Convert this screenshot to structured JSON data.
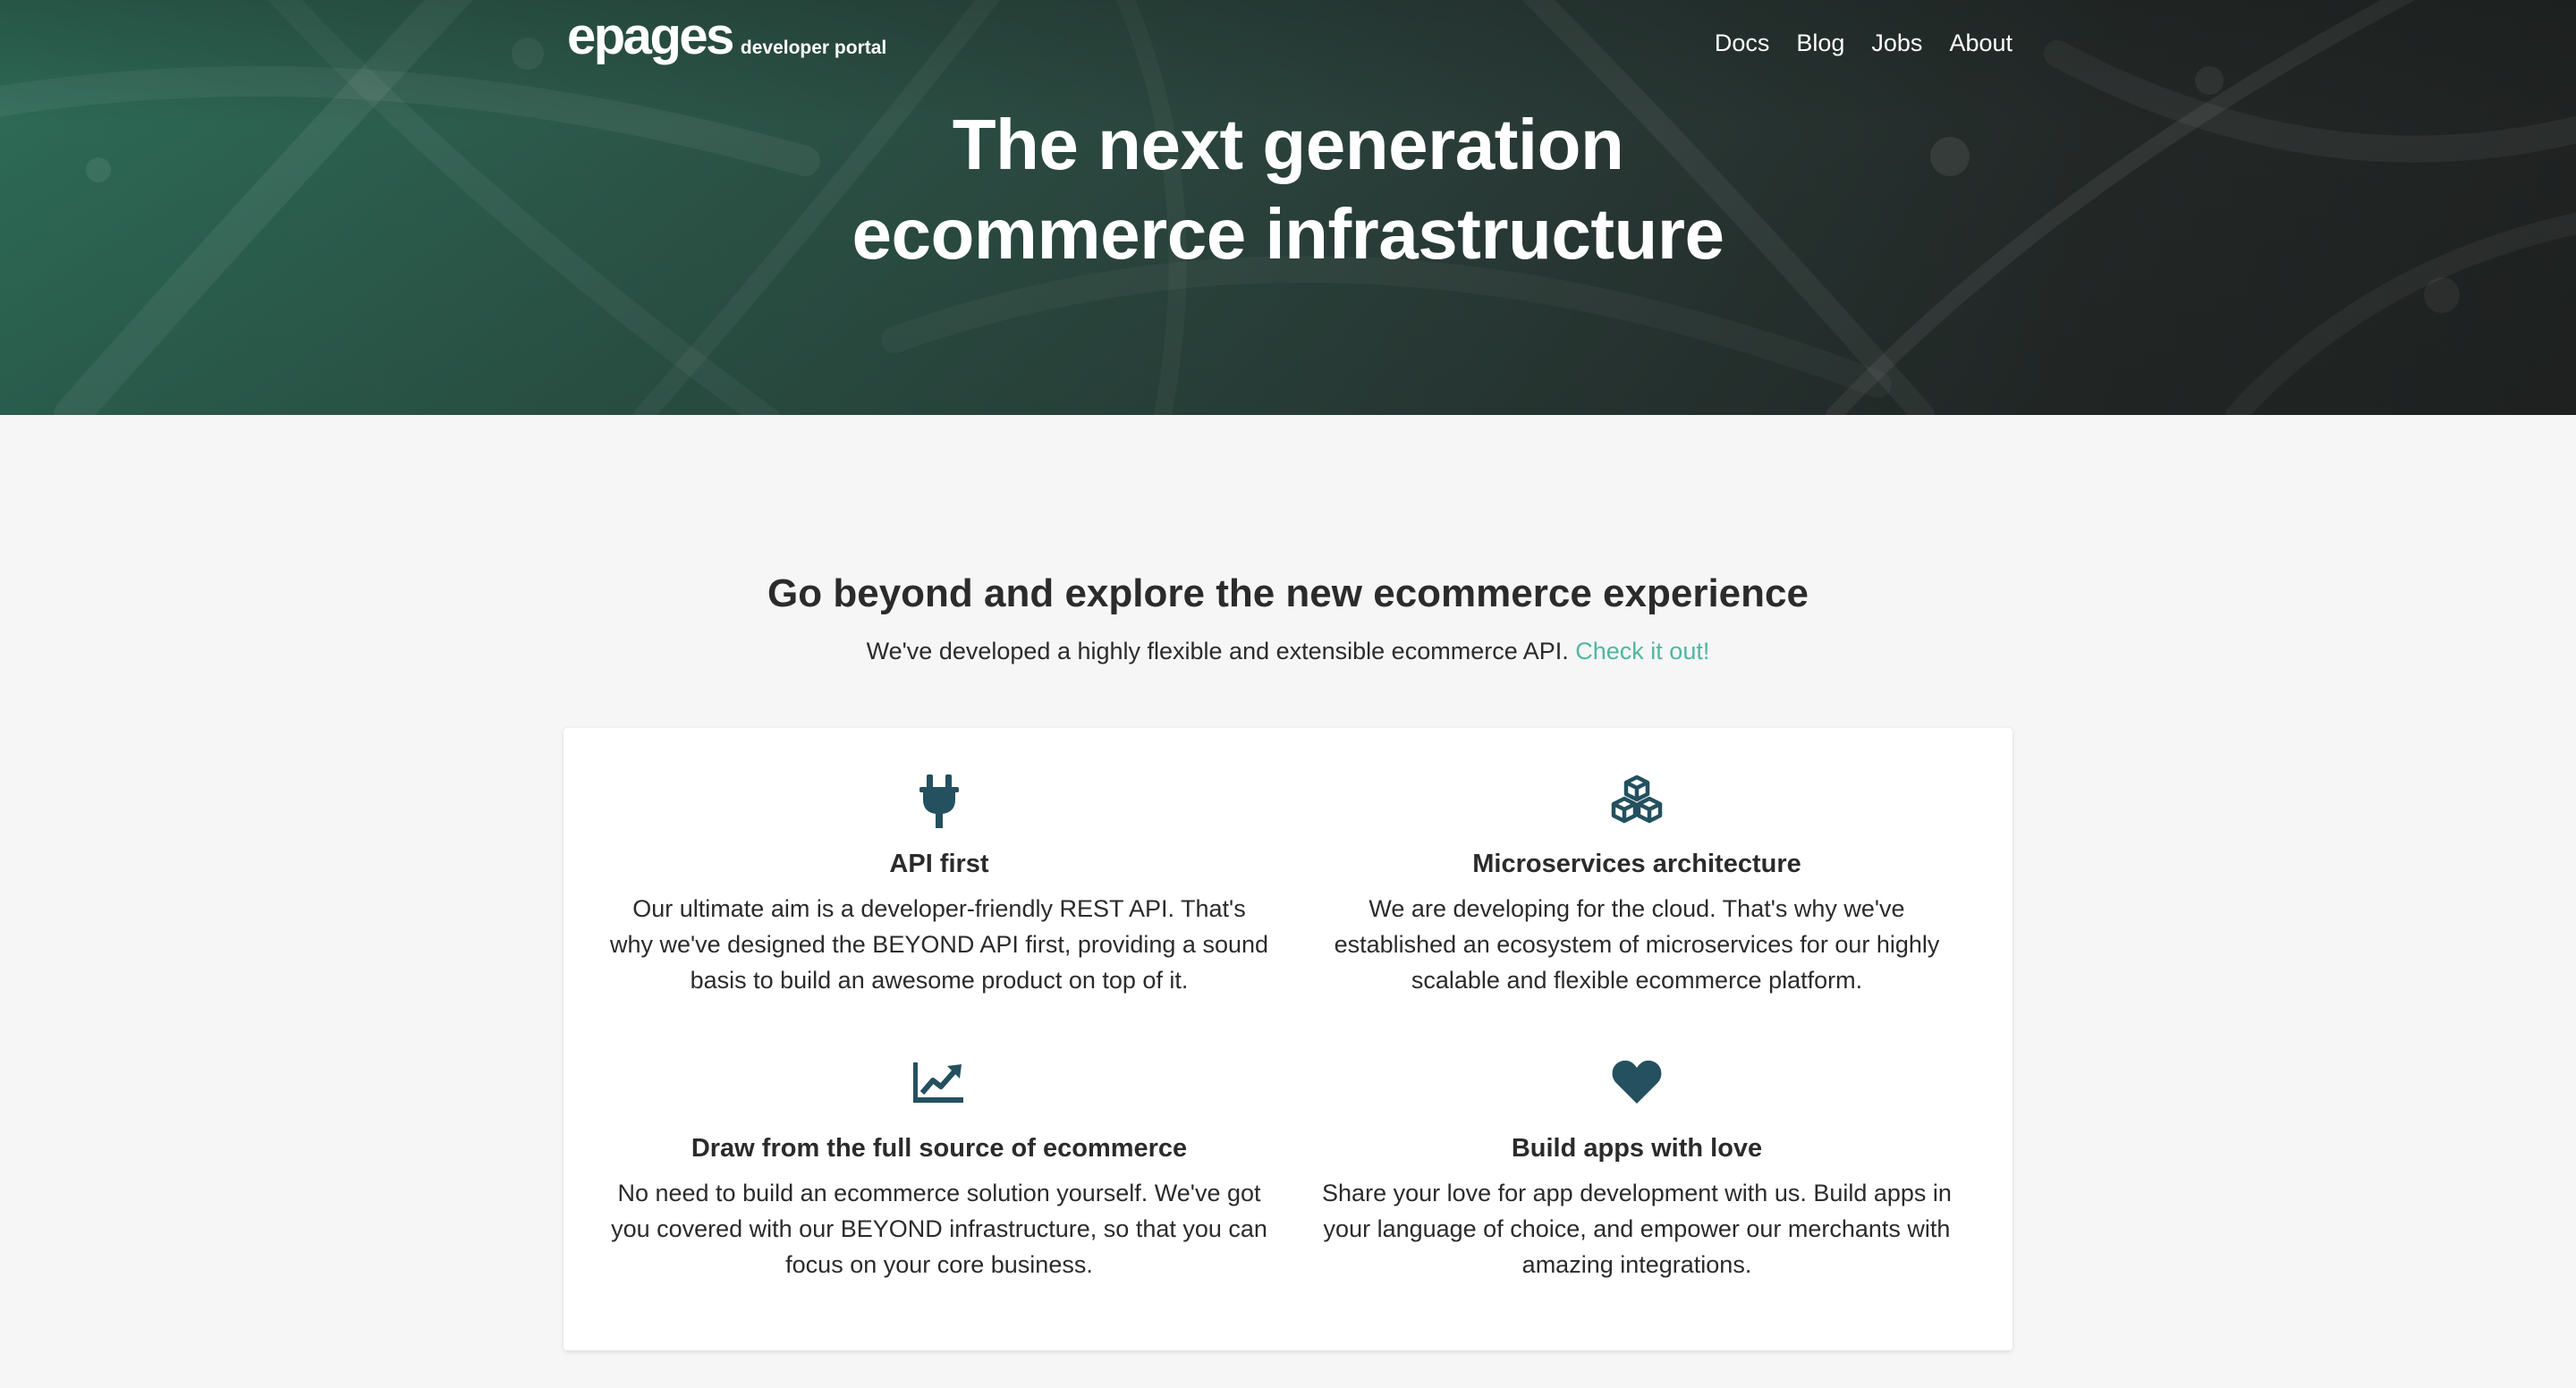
{
  "header": {
    "logo_text": "epages",
    "logo_subtitle": "developer portal",
    "nav": [
      {
        "label": "Docs"
      },
      {
        "label": "Blog"
      },
      {
        "label": "Jobs"
      },
      {
        "label": "About"
      }
    ]
  },
  "hero": {
    "title_line1": "The next generation",
    "title_line2": "ecommerce infrastructure"
  },
  "intro": {
    "heading": "Go beyond and explore the new ecommerce experience",
    "text": "We've developed a highly flexible and extensible ecommerce API.",
    "link_label": "Check it out!"
  },
  "features": [
    {
      "icon": "plug-icon",
      "title": "API first",
      "text": "Our ultimate aim is a developer-friendly REST API. That's why we've designed the BEYOND API first, providing a sound basis to build an awesome product on top of it."
    },
    {
      "icon": "cubes-icon",
      "title": "Microservices architecture",
      "text": "We are developing for the cloud. That's why we've established an ecosystem of microservices for our highly scalable and flexible ecommerce platform."
    },
    {
      "icon": "line-chart-icon",
      "title": "Draw from the full source of ecommerce",
      "text": "No need to build an ecommerce solution yourself. We've got you covered with our BEYOND infrastructure, so that you can focus on your core business."
    },
    {
      "icon": "heart-icon",
      "title": "Build apps with love",
      "text": "Share your love for app development with us. Build apps in your language of choice, and empower our merchants with amazing integrations."
    }
  ],
  "colors": {
    "accent": "#4fb7a0",
    "icon": "#24505f",
    "page_background": "#f6f6f6",
    "hero_green": "#2d6a56",
    "hero_dark": "#1f2221"
  }
}
